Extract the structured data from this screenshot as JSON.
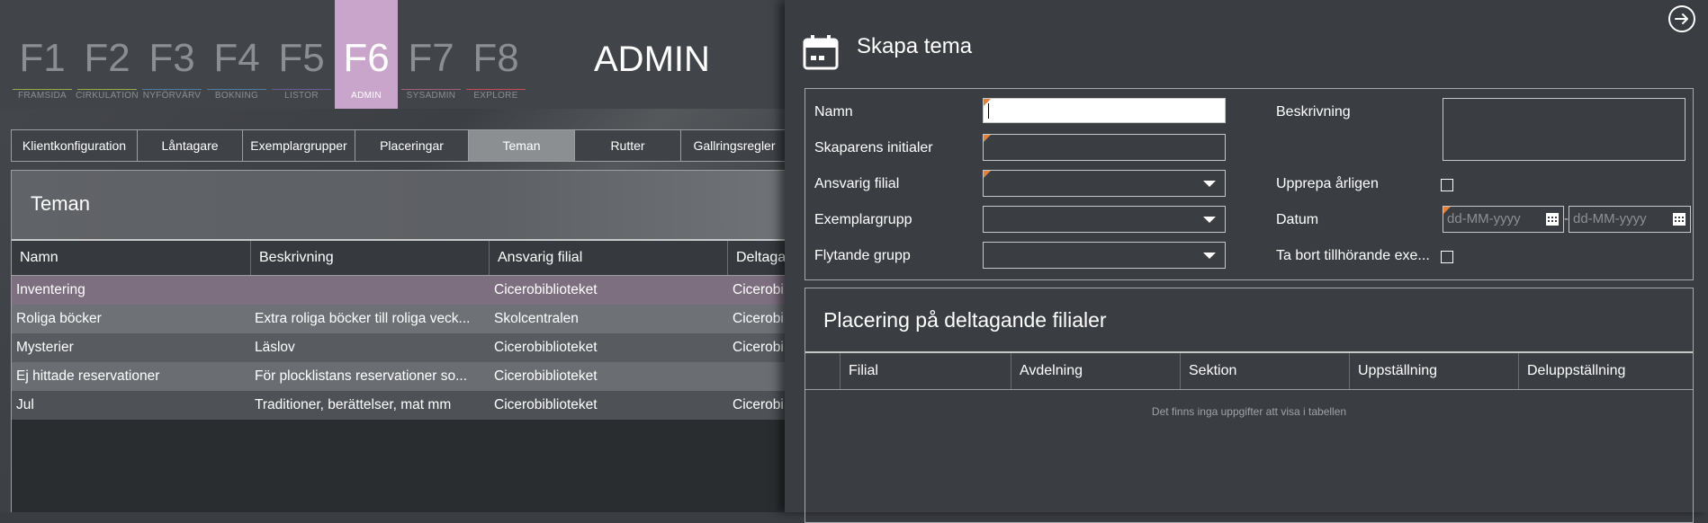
{
  "fkeys": [
    {
      "num": "F1",
      "label": "FRAMSIDA",
      "color": "#9aa84a"
    },
    {
      "num": "F2",
      "label": "CIRKULATION",
      "color": "#9aa84a"
    },
    {
      "num": "F3",
      "label": "NYFÖRVÄRV",
      "color": "#4a7aa8"
    },
    {
      "num": "F4",
      "label": "BOKNING",
      "color": "#4a7aa8"
    },
    {
      "num": "F5",
      "label": "LISTOR",
      "color": "#6a5a9a"
    },
    {
      "num": "F6",
      "label": "ADMIN",
      "color": "#c9a5cc"
    },
    {
      "num": "F7",
      "label": "SYSADMIN",
      "color": "#a85a7a"
    },
    {
      "num": "F8",
      "label": "EXPLORE",
      "color": "#c84a5a"
    }
  ],
  "admin_title": "ADMIN",
  "tabs": [
    "Klientkonfiguration",
    "Låntagare",
    "Exemplargrupper",
    "Placeringar",
    "Teman",
    "Rutter",
    "Gallringsregler"
  ],
  "grid": {
    "title": "Teman",
    "columns": [
      "Namn",
      "Beskrivning",
      "Ansvarig filial",
      "Deltaga"
    ],
    "rows": [
      [
        "Inventering",
        "",
        "Cicerobiblioteket",
        "Cicerobi"
      ],
      [
        "Roliga böcker",
        "Extra roliga böcker till roliga  veck...",
        "Skolcentralen",
        "Cicerobi"
      ],
      [
        "Mysterier",
        "Läslov",
        "Cicerobiblioteket",
        "Cicerobi"
      ],
      [
        "Ej hittade reservationer",
        "För plocklistans reservationer so...",
        "Cicerobiblioteket",
        ""
      ],
      [
        "Jul",
        "Traditioner, berättelser, mat mm",
        "Cicerobiblioteket",
        "Cicerobi"
      ]
    ]
  },
  "dialog": {
    "title": "Skapa tema",
    "labels": {
      "namn": "Namn",
      "initialer": "Skaparens initialer",
      "filial": "Ansvarig filial",
      "exemplargrupp": "Exemplargrupp",
      "flytande": "Flytande grupp",
      "beskrivning": "Beskrivning",
      "upprepa": "Upprepa årligen",
      "datum": "Datum",
      "tabort": "Ta bort tillhörande exe..."
    },
    "date_placeholder": "dd-MM-yyyy",
    "date_separator": "-",
    "placement": {
      "title": "Placering på deltagande filialer",
      "columns": [
        "Filial",
        "Avdelning",
        "Sektion",
        "Uppställning",
        "Deluppställning"
      ],
      "empty": "Det finns inga uppgifter att visa i tabellen"
    }
  }
}
